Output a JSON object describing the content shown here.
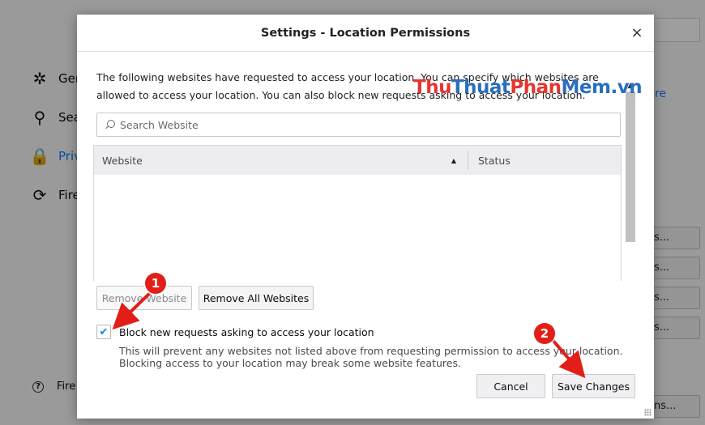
{
  "background": {
    "nav_items": [
      {
        "label": "Ger",
        "icon": "gear-icon",
        "glyph": "✲"
      },
      {
        "label": "Sea",
        "icon": "search-icon",
        "glyph": "⚲"
      },
      {
        "label": "Priv",
        "icon": "lock-icon",
        "glyph": "🔒"
      },
      {
        "label": "Fire",
        "icon": "sync-icon",
        "glyph": "⟳"
      }
    ],
    "link_text": "re",
    "side_buttons": [
      "s...",
      "s...",
      "s...",
      "s...",
      "ns..."
    ],
    "help_text": "Fire"
  },
  "dialog": {
    "title": "Settings - Location Permissions",
    "close_glyph": "×",
    "description": "The following websites have requested to access your location. You can specify which websites are allowed to access your location. You can also block new requests asking to access your location.",
    "search": {
      "placeholder": "Search Website",
      "value": ""
    },
    "table": {
      "columns": [
        "Website",
        "Status"
      ],
      "sort_indicator": "▲",
      "rows": []
    },
    "buttons": {
      "remove_website": "Remove Website",
      "remove_all": "Remove All Websites",
      "cancel": "Cancel",
      "save": "Save Changes"
    },
    "block_checkbox": {
      "checked": true,
      "label": "Block new requests asking to access your location",
      "description": "This will prevent any websites not listed above from requesting permission to access your location. Blocking access to your location may break some website features."
    }
  },
  "watermark": {
    "part1": "Thu",
    "part2": "Thuat",
    "part3": "Phan",
    "part4": "Mem.vn"
  },
  "annotations": [
    {
      "number": "1"
    },
    {
      "number": "2"
    }
  ],
  "colors": {
    "accent": "#0a84ff",
    "annotation": "#e11f18"
  }
}
